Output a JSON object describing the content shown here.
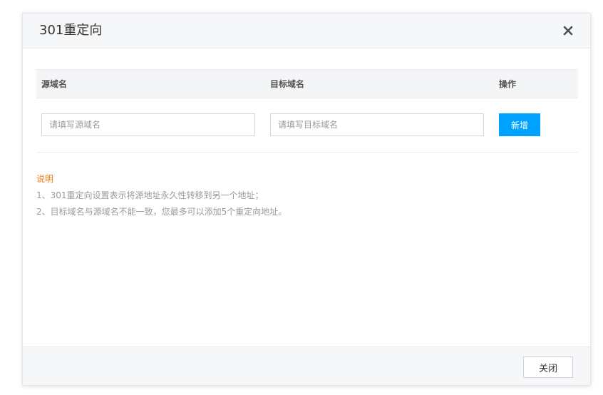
{
  "dialog": {
    "title": "301重定向",
    "close_icon": "close-icon"
  },
  "table": {
    "headers": {
      "source": "源域名",
      "target": "目标域名",
      "operation": "操作"
    },
    "source_placeholder": "请填写源域名",
    "target_placeholder": "请填写目标域名",
    "add_label": "新增"
  },
  "notes": {
    "title": "说明",
    "lines": [
      "1、301重定向设置表示将源地址永久性转移到另一个地址；",
      "2、目标域名与源域名不能一致，您最多可以添加5个重定向地址。"
    ]
  },
  "footer": {
    "close_label": "关闭"
  },
  "colors": {
    "primary": "#00a2ff",
    "notes_title": "#f07c12",
    "muted_text": "#9a9a9a"
  }
}
